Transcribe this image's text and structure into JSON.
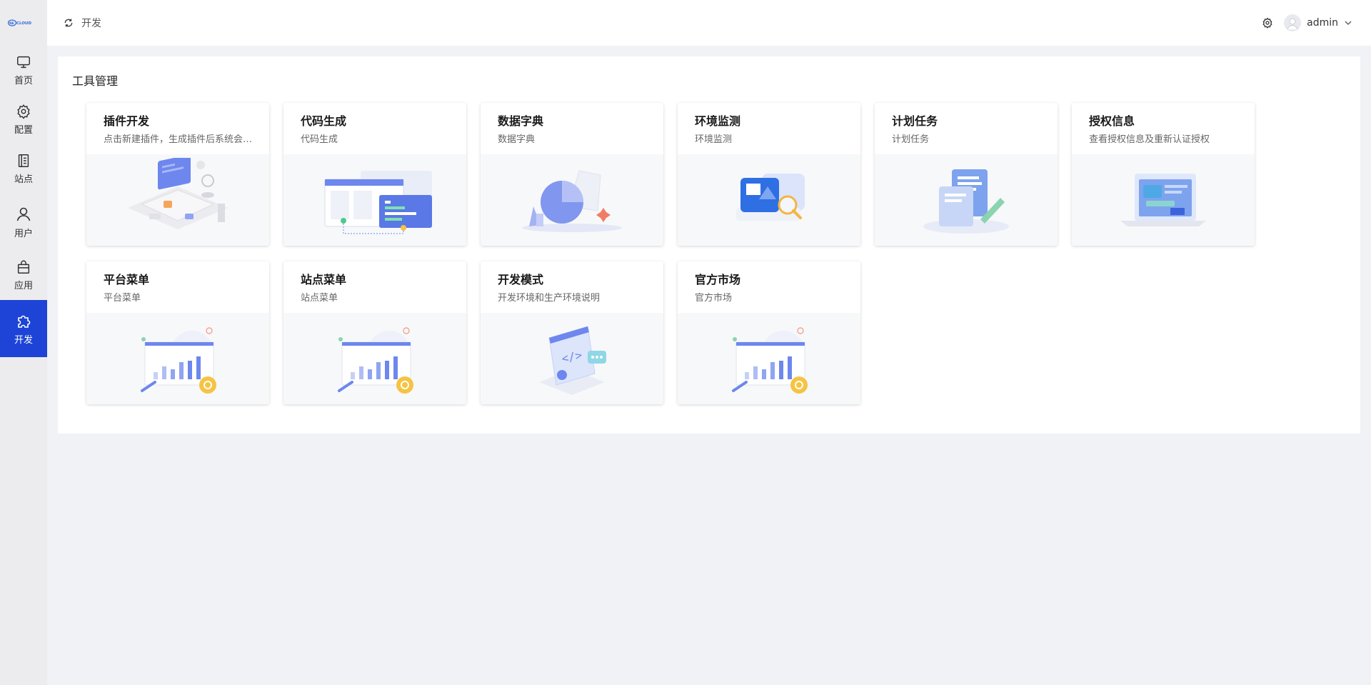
{
  "brand": {
    "logo_text": "NEWCLOUD"
  },
  "sidebar": {
    "items": [
      {
        "label": "首页",
        "icon": "monitor-icon"
      },
      {
        "label": "配置",
        "icon": "gear-icon"
      },
      {
        "label": "站点",
        "icon": "document-icon"
      },
      {
        "label": "用户",
        "icon": "user-icon"
      },
      {
        "label": "应用",
        "icon": "shopping-bag-icon"
      },
      {
        "label": "开发",
        "icon": "puzzle-icon",
        "active": true
      }
    ]
  },
  "header": {
    "breadcrumb": "开发",
    "username": "admin"
  },
  "panel": {
    "title": "工具管理",
    "cards": [
      {
        "title": "插件开发",
        "desc": "点击新建插件，生成插件后系统会自动生成插件代码",
        "illustration": "plugin-illustration"
      },
      {
        "title": "代码生成",
        "desc": "代码生成",
        "illustration": "code-gen-illustration"
      },
      {
        "title": "数据字典",
        "desc": "数据字典",
        "illustration": "pie-chart-illustration"
      },
      {
        "title": "环境监测",
        "desc": "环境监测",
        "illustration": "monitor-search-illustration"
      },
      {
        "title": "计划任务",
        "desc": "计划任务",
        "illustration": "task-doc-illustration"
      },
      {
        "title": "授权信息",
        "desc": "查看授权信息及重新认证授权",
        "illustration": "laptop-illustration"
      },
      {
        "title": "平台菜单",
        "desc": "平台菜单",
        "illustration": "bar-chart-illustration"
      },
      {
        "title": "站点菜单",
        "desc": "站点菜单",
        "illustration": "bar-chart-illustration"
      },
      {
        "title": "开发模式",
        "desc": "开发环境和生产环境说明",
        "illustration": "code-window-illustration"
      },
      {
        "title": "官方市场",
        "desc": "官方市场",
        "illustration": "bar-chart-illustration"
      }
    ]
  },
  "colors": {
    "accent": "#1d44d6",
    "sidebar_bg": "#ececee",
    "page_bg": "#f0f2f5"
  }
}
